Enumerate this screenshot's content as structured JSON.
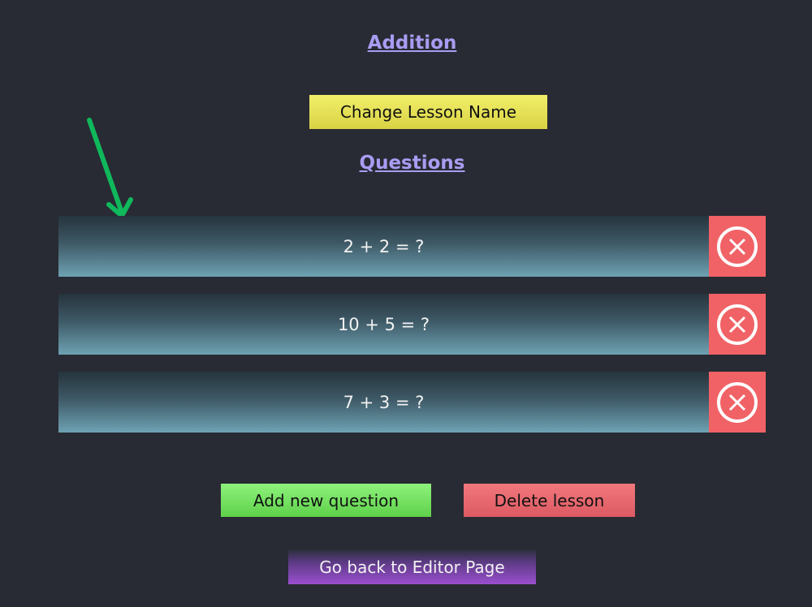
{
  "lesson": {
    "title": "Addition"
  },
  "buttons": {
    "change_lesson_name": "Change Lesson Name",
    "add_new_question": "Add new question",
    "delete_lesson": "Delete lesson",
    "go_back": "Go back to Editor Page"
  },
  "questions_section": {
    "title": "Questions"
  },
  "questions": [
    {
      "text": "2 + 2 = ?"
    },
    {
      "text": "10 + 5 = ?"
    },
    {
      "text": "7 + 3 = ?"
    }
  ],
  "icons": {
    "delete_question": "close-circle-icon",
    "annotation": "arrow-down-icon"
  },
  "colors": {
    "background": "#282b33",
    "title": "#a99cf2",
    "change_button": "#e6e356",
    "add_button": "#76e064",
    "delete_button": "#e8686f",
    "back_button": "#9b4fd0",
    "question_delete": "#f06266",
    "annotation_arrow": "#10b85c"
  }
}
